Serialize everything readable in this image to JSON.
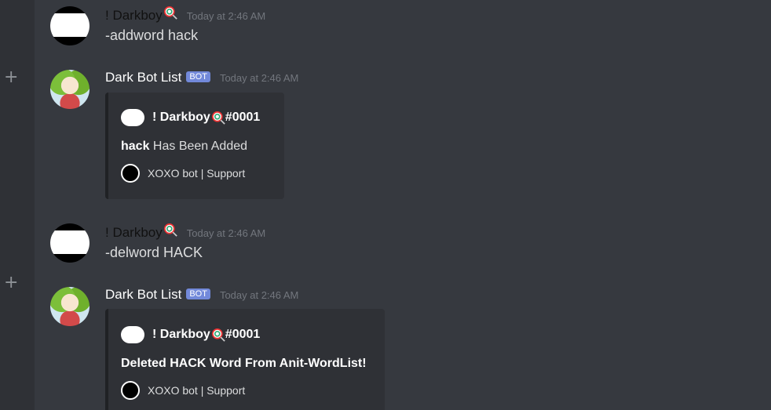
{
  "messages": [
    {
      "author": "! Darkboy",
      "timestamp": "Today at 2:46 AM",
      "content": "-addword hack"
    },
    {
      "author": "Dark Bot List",
      "tag": "BOT",
      "timestamp": "Today at 2:46 AM",
      "embed": {
        "author_name": "! Darkboy",
        "author_suffix": "#0001",
        "desc_bold": "hack",
        "desc_rest": " Has Been Added",
        "footer": "XOXO bot | Support"
      }
    },
    {
      "author": "! Darkboy",
      "timestamp": "Today at 2:46 AM",
      "content": "-delword HACK"
    },
    {
      "author": "Dark Bot List",
      "tag": "BOT",
      "timestamp": "Today at 2:46 AM",
      "embed": {
        "author_name": "! Darkboy",
        "author_suffix": "#0001",
        "desc_bold": "Deleted HACK Word From Anit-WordList!",
        "desc_rest": "",
        "footer": "XOXO bot | Support"
      }
    }
  ],
  "icons": {
    "plus": "+",
    "lollipop": "lollipop-icon"
  }
}
